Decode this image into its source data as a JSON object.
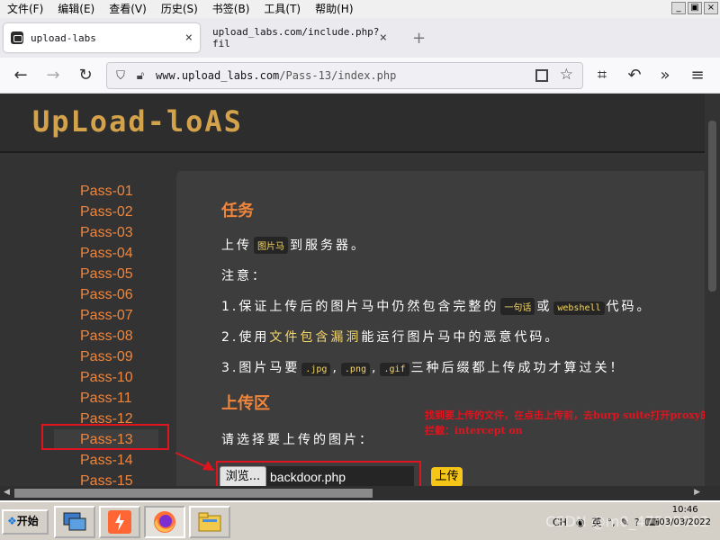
{
  "menubar": {
    "items": [
      "文件(F)",
      "编辑(E)",
      "查看(V)",
      "历史(S)",
      "书签(B)",
      "工具(T)",
      "帮助(H)"
    ],
    "win_min": "_",
    "win_max": "▣",
    "win_close": "×"
  },
  "tabs": [
    {
      "label": "upload-labs",
      "close": "×",
      "icon": "upload-labs-favicon-icon"
    },
    {
      "label": "upload_labs.com/include.php?fil",
      "close": "×"
    }
  ],
  "newtab": "+",
  "nav": {
    "back": "←",
    "forward": "→",
    "reload": "↻",
    "url_host": "www.upload_labs.com",
    "url_path": "/Pass-13/index.php",
    "menu": "≡",
    "overflow": "»"
  },
  "page": {
    "logo": "UpLoad-loAS",
    "passes": [
      "Pass-01",
      "Pass-02",
      "Pass-03",
      "Pass-04",
      "Pass-05",
      "Pass-06",
      "Pass-07",
      "Pass-08",
      "Pass-09",
      "Pass-10",
      "Pass-11",
      "Pass-12",
      "Pass-13",
      "Pass-14",
      "Pass-15"
    ],
    "active_pass": "Pass-13",
    "task_heading": "任务",
    "task_line1_a": "上传",
    "task_line1_code": "图片马",
    "task_line1_b": "到服务器。",
    "notice": "注意：",
    "n1_a": "1.保证上传后的图片马中仍然包含完整的",
    "n1_code1": "一句话",
    "n1_mid": "或",
    "n1_code2": "webshell",
    "n1_b": "代码。",
    "n2_a": "2.使用",
    "n2_hl": "文件包含漏洞",
    "n2_b": "能运行图片马中的恶意代码。",
    "n3_a": "3.图片马要",
    "n3_c1": ".jpg",
    "n3_sep1": ",",
    "n3_c2": ".png",
    "n3_sep2": ",",
    "n3_c3": ".gif",
    "n3_b": "三种后缀都上传成功才算过关！",
    "upload_heading": "上传区",
    "choose_label": "请选择要上传的图片：",
    "annotation": "找到要上传的文件，在点击上传前，去burp suite打开proxy的拦截：intercept on",
    "browse": "浏览...",
    "file_name": "backdoor.php",
    "upload_button": "上传"
  },
  "taskbar": {
    "start": "开始",
    "apps": [
      "network-connection-icon",
      "burp-suite-icon",
      "firefox-icon",
      "explorer-folder-icon"
    ],
    "tray_lang": "CH",
    "clock_time": "10:46",
    "clock_date": "03/03/2022",
    "watermark": "CSDN @m0_47505062"
  },
  "colors": {
    "accent_orange": "#f0853c",
    "code_yellow": "#f5d769",
    "annotation_red": "#e0141e",
    "upload_yellow": "#f5c518"
  }
}
